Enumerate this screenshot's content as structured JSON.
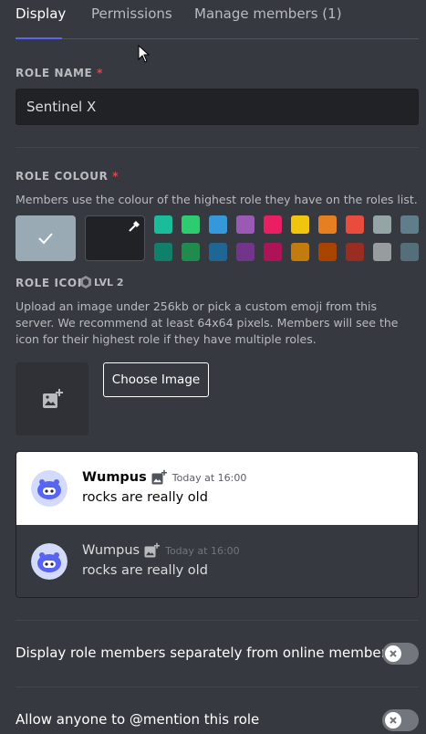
{
  "tabs": [
    {
      "label": "Display",
      "active": true
    },
    {
      "label": "Permissions",
      "active": false
    },
    {
      "label": "Manage members (1)",
      "active": false
    }
  ],
  "role_name": {
    "label": "ROLE NAME",
    "required_mark": "*",
    "value": "Sentinel X"
  },
  "role_colour": {
    "label": "ROLE COLOUR",
    "required_mark": "*",
    "help": "Members use the colour of the highest role they have on the roles list.",
    "default_color": "#99aab5",
    "selected": "default",
    "swatches_top": [
      "#1abc9c",
      "#2ecc71",
      "#3498db",
      "#9b59b6",
      "#e91e63",
      "#f1c40f",
      "#e67e22",
      "#e74c3c",
      "#95a5a6",
      "#607d8b"
    ],
    "swatches_bottom": [
      "#11806a",
      "#1f8b4c",
      "#206694",
      "#71368a",
      "#ad1457",
      "#c27c0e",
      "#a84300",
      "#992d22",
      "#979c9f",
      "#546e7a"
    ]
  },
  "role_icon": {
    "label": "ROLE ICON",
    "badge": "LVL 2",
    "help": "Upload an image under 256kb or pick a custom emoji from this server. We recommend at least 64x64 pixels. Members will see the icon for their highest role if they have multiple roles.",
    "button": "Choose Image"
  },
  "preview": {
    "author": "Wumpus",
    "timestamp": "Today at 16:00",
    "message": "rocks are really old"
  },
  "settings": [
    {
      "label": "Display role members separately from online members",
      "enabled": false
    },
    {
      "label": "Allow anyone to @mention this role",
      "enabled": false
    }
  ],
  "colors": {
    "accent": "#5865f2",
    "required": "#ed4245",
    "background": "#36393f"
  }
}
